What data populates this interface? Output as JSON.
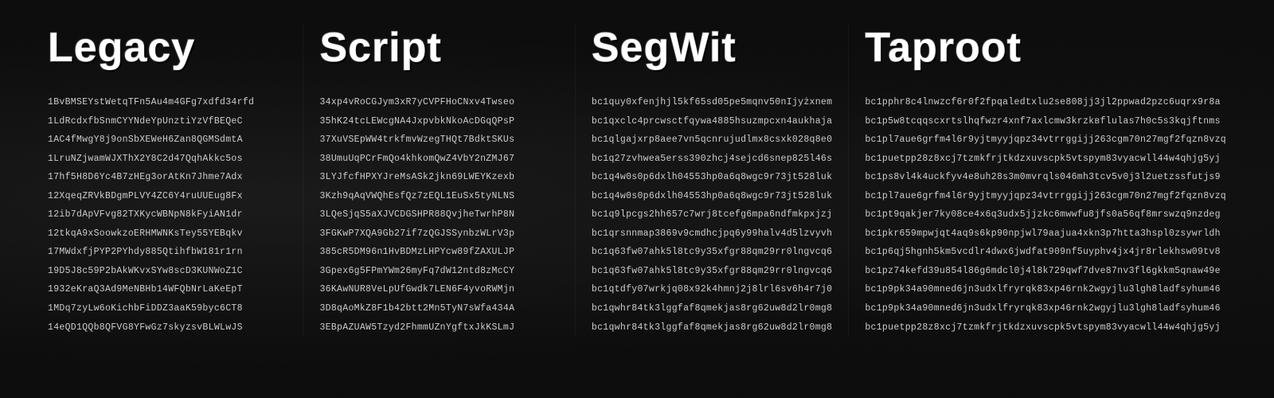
{
  "columns": [
    {
      "id": "legacy",
      "header": "Legacy",
      "addresses": [
        "1BvBMSEYstWetqTFn5Au4m4GFg7xdfd34rfd",
        "1LdRcdxfbSnmCYYNdeYpUnztiYzVfBEQeC",
        "1AC4fMwgY8j9onSbXEWeH6Zan8QGMSdmtA",
        "1LruNZjwamWJXThX2Y8C2d47QqhAkkc5os",
        "17hf5H8D6Yc4B7zHEg3orAtKn7Jhme7Adx",
        "12XqeqZRVkBDgmPLVY4ZC6Y4ruUUEug8Fx",
        "12ib7dApVFvg82TXKycWBNpN8kFyiAN1dr",
        "12tkqA9xSoowkzoERHMWNKsTey55YEBqkv",
        "17MWdxfjPYP2PYhdy885QtihfbW181r1rn",
        "19D5J8c59P2bAkWKvxSYw8scD3KUNWoZ1C",
        "1932eKraQ3Ad9MeNBHb14WFQbNrLaKeEpT",
        "1MDq7zyLw6oKichbFiDDZ3aaK59byc6CT8",
        "14eQD1QQb8QFVG8YFwGz7skyzsvBLWLwJS"
      ]
    },
    {
      "id": "script",
      "header": "Script",
      "addresses": [
        "34xp4vRoCGJym3xR7yCVPFHoCNxv4Twseo",
        "35hK24tcLEWcgNA4JxpvbkNkoAcDGqQPsP",
        "37XuVSEpWW4trkfmvWzegTHQt7BdktSKUs",
        "38UmuUqPCrFmQo4khkomQwZ4VbY2nZMJ67",
        "3LYJfcfHPXYJreMsASk2jkn69LWEYKzexb",
        "3Kzh9qAqVWQhEsfQz7zEQL1EuSx5tyNLNS",
        "3LQeSjqS5aXJVCDGSHPR88QvjheTwrhP8N",
        "3FGKwP7XQA9Gb27if7zQGJSSynbzWLrV3p",
        "385cR5DM96n1HvBDMzLHPYcw89fZAXULJP",
        "3Gpex6g5FPmYWm26myFq7dW12ntd8zMcCY",
        "36KAwNUR8VeLpUfGwdk7LEN6F4yvoRWMjn",
        "3D8qAoMkZ8F1b42btt2Mn5TyN7sWfa434A",
        "3EBpAZUAW5Tzyd2FhmmUZnYgftxJkKSLmJ"
      ]
    },
    {
      "id": "segwit",
      "header": "SegWit",
      "addresses": [
        "bc1quy0xfenjhjl5kf65sd05pe5mqnv50nIjyżxnem",
        "bc1qxclc4prcwsctfqywa4885hsuzmpcxn4aukhaja",
        "bc1qlgajxrp8aee7vn5qcnrujudlmx8csxk028q8e0",
        "bc1q27zvhwea5erss390zhcj4sejcd6snep825l46s",
        "bc1q4w0s0p6dxlh04553hp0a6q8wgc9r73jt528luk",
        "bc1q4w0s0p6dxlh04553hp0a6q8wgc9r73jt528luk",
        "bc1q9lpcgs2hh657c7wrj8tcefg6mpa6ndfmkpxjzj",
        "bc1qrsnnmap3869v9cmdhcjpq6y99halv4d5lzvyvh",
        "bc1q63fw07ahk5l8tc9y35xfgr88qm29rr0lngvcq6",
        "bc1q63fw07ahk5l8tc9y35xfgr88qm29rr0lngvcq6",
        "bc1qtdfy07wrkjq08x92k4hmnj2j8lrl6sv6h4r7j0",
        "bc1qwhr84tk3lggfaf8qmekjas8rg62uw8d2lr0mg8",
        "bc1qwhr84tk3lggfaf8qmekjas8rg62uw8d2lr0mg8"
      ]
    },
    {
      "id": "taproot",
      "header": "Taproot",
      "addresses": [
        "bc1pphr8c4lnwzcf6r0f2fpqaledtxlu2se808jj3jl2ppwad2pzc6uqrx9r8a",
        "bc1p5w8tcqqscxrtslhqfwzr4xnf7axlcmw3krzkвflulas7h0c5s3kqjftnms",
        "bc1pl7aue6grfm4l6r9yjtmyyjqpz34vtrrggijj263cgm70n27mgf2fqzn8vzq",
        "bc1puetpp28z8xcj7tzmkfrjtkdzxuvscpk5vtspym83vyacwll44w4qhjg5yj",
        "bc1ps8vl4k4uckfyv4e8uh28s3m0mvrqls046mh3tcv5v0j3l2uetzssfutjs9",
        "bc1pl7aue6grfm4l6r9yjtmyyjqpz34vtrrggijj263cgm70n27mgf2fqzn8vzq",
        "bc1pt9qakjer7ky08ce4x6q3udx5jjzkc6mwwfu8jfs0a56qf8mrswzq9nzdeg",
        "bc1pkr659mpwjqt4aq9s6kp90npjwl79aajua4xkn3p7htta3hspl0zsywrldh",
        "bc1p6qj5hgnh5km5vcdlr4dwx6jwdfat909nf5uyphv4jx4jr8rlekhsw09tv8",
        "bc1pz74kefd39u854l86g6mdcl0j4l8k729qwf7dve87nv3fl6gkkm5qnaw49e",
        "bc1p9pk34a90mned6jn3udxlfryrqk83xp46rnk2wgyjlu3lgh8ladfsyhum46",
        "bc1p9pk34a90mned6jn3udxlfryrqk83xp46rnk2wgyjlu3lgh8ladfsyhum46",
        "bc1puetpp28z8xcj7tzmkfrjtkdzxuvscpk5vtspym83vyacwll44w4qhjg5yj"
      ]
    }
  ]
}
